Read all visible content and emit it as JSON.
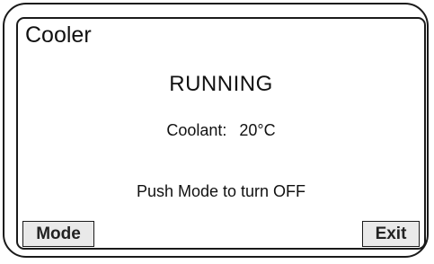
{
  "screen": {
    "title": "Cooler",
    "status": "RUNNING",
    "coolant_label": "Coolant:",
    "coolant_value": "20°C",
    "hint": "Push Mode to turn OFF"
  },
  "buttons": {
    "mode_label": "Mode",
    "exit_label": "Exit"
  },
  "colors": {
    "frame": "#1a1a1a",
    "button_bg": "#e9e9e9",
    "text": "#111111"
  }
}
